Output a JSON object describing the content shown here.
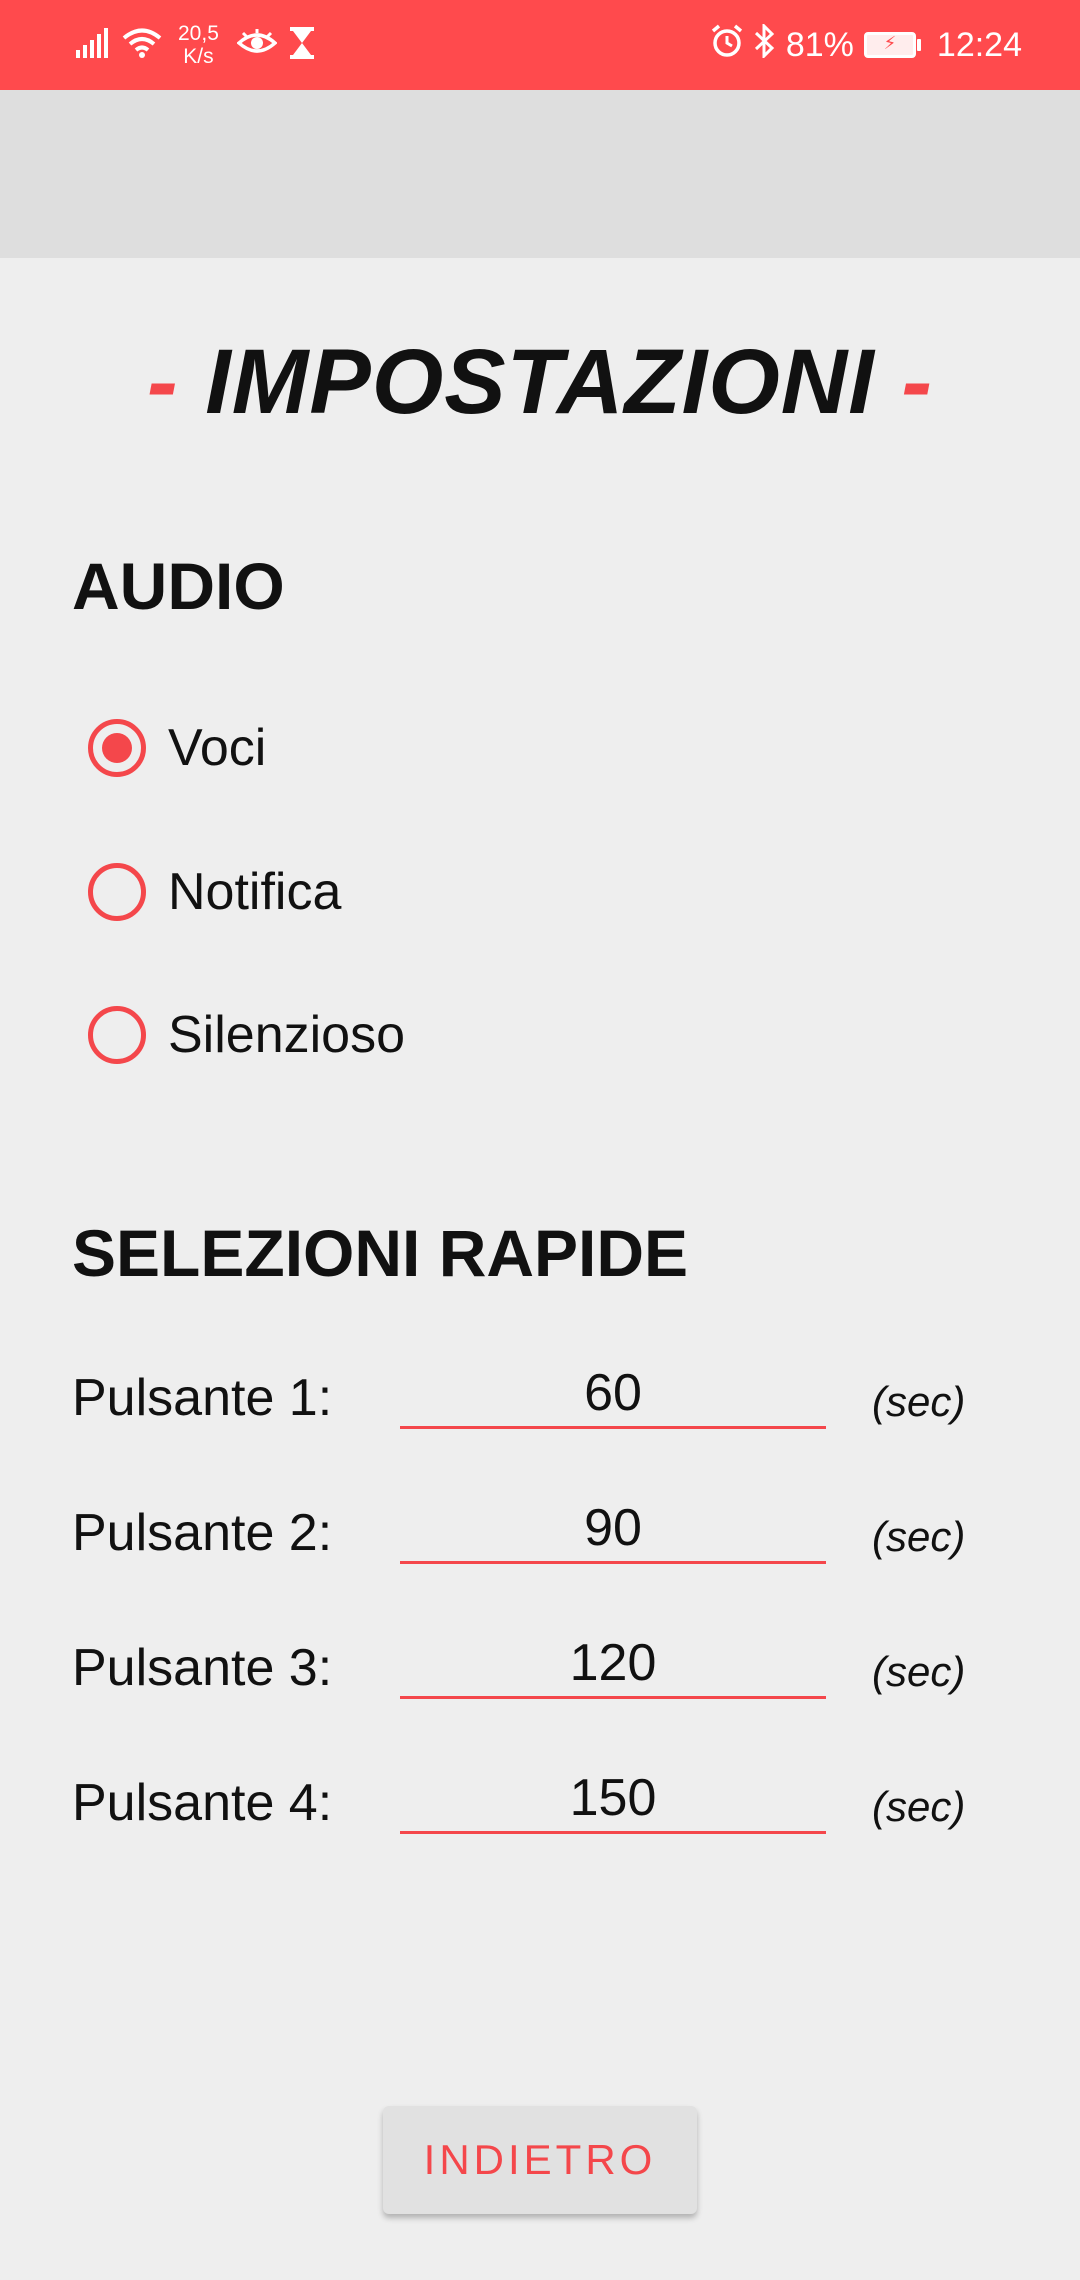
{
  "status_bar": {
    "speed_top": "20,5",
    "speed_bottom": "K/s",
    "battery_percent": "81%",
    "time": "12:24",
    "icons": [
      "signal-icon",
      "wifi-icon",
      "eye-icon",
      "hourglass-icon",
      "alarm-icon",
      "bluetooth-icon",
      "battery-icon"
    ]
  },
  "header": {
    "dash_left": "-",
    "title": "IMPOSTAZIONI",
    "dash_right": "-"
  },
  "audio": {
    "title": "AUDIO",
    "options": [
      {
        "label": "Voci",
        "selected": true
      },
      {
        "label": "Notifica",
        "selected": false
      },
      {
        "label": "Silenzioso",
        "selected": false
      }
    ]
  },
  "quick": {
    "title": "SELEZIONI RAPIDE",
    "rows": [
      {
        "label": "Pulsante 1:",
        "value": "60",
        "unit": "(sec)"
      },
      {
        "label": "Pulsante 2:",
        "value": "90",
        "unit": "(sec)"
      },
      {
        "label": "Pulsante 3:",
        "value": "120",
        "unit": "(sec)"
      },
      {
        "label": "Pulsante 4:",
        "value": "150",
        "unit": "(sec)"
      }
    ]
  },
  "back_button": {
    "label": "INDIETRO"
  },
  "colors": {
    "status_bar": "#ff4a4d",
    "accent": "#f4474b",
    "background": "#eeeeee",
    "appbar": "#dedede"
  }
}
